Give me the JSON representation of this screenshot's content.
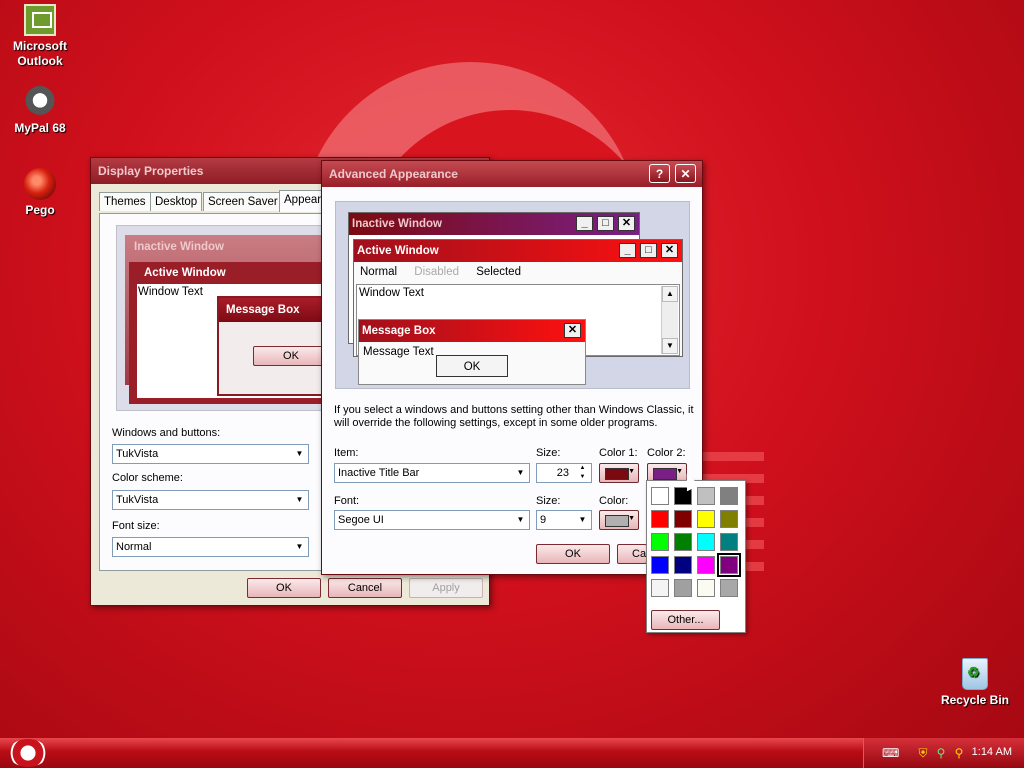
{
  "desktop": {
    "icons": [
      {
        "label_line1": "Microsoft",
        "label_line2": "Outlook",
        "icon": "outlook-icon"
      },
      {
        "label_line1": "MyPal 68",
        "label_line2": "",
        "icon": "mypal-icon"
      },
      {
        "label_line1": "Pego",
        "label_line2": "",
        "icon": "pego-icon"
      },
      {
        "label_line1": "Recycle Bin",
        "label_line2": "",
        "icon": "recycle-bin-icon"
      }
    ]
  },
  "display_properties": {
    "title": "Display Properties",
    "tabs": [
      "Themes",
      "Desktop",
      "Screen Saver",
      "Appearance"
    ],
    "preview": {
      "inactive_title": "Inactive Window",
      "active_title": "Active Window",
      "window_text": "Window Text",
      "message_box_title": "Message Box",
      "ok": "OK"
    },
    "windows_buttons_label": "Windows and buttons:",
    "windows_buttons_value": "TukVista",
    "color_scheme_label": "Color scheme:",
    "color_scheme_value": "TukVista",
    "font_size_label": "Font size:",
    "font_size_value": "Normal",
    "ok": "OK",
    "cancel": "Cancel",
    "apply": "Apply"
  },
  "advanced_appearance": {
    "title": "Advanced Appearance",
    "help_btn": "?",
    "close_btn": "✕",
    "preview": {
      "inactive_title": "Inactive Window",
      "active_title": "Active Window",
      "menu_normal": "Normal",
      "menu_disabled": "Disabled",
      "menu_selected": "Selected",
      "window_text": "Window Text",
      "message_box_title": "Message Box",
      "message_text": "Message Text",
      "ok": "OK"
    },
    "notice": "If you select a windows and buttons setting other than Windows Classic, it will override the following settings, except in some older programs.",
    "item_label": "Item:",
    "item_value": "Inactive Title Bar",
    "size_label": "Size:",
    "item_size_value": "23",
    "color1_label": "Color 1:",
    "color2_label": "Color 2:",
    "font_label": "Font:",
    "font_value": "Segoe UI",
    "font_size_label": "Size:",
    "font_size_value": "9",
    "font_color_label": "Color:",
    "ok": "OK",
    "cancel": "Ca",
    "colors": {
      "color1": "#7b0a10",
      "color2": "#7a1f86",
      "font_color": "#b0b0b0"
    }
  },
  "color_popup": {
    "swatches": [
      "#ffffff",
      "#000000",
      "#c0c0c0",
      "#808080",
      "#ff0000",
      "#800000",
      "#ffff00",
      "#808000",
      "#00ff00",
      "#008000",
      "#00ffff",
      "#008080",
      "#0000ff",
      "#000080",
      "#ff00ff",
      "#800080",
      "#f4f4f4",
      "#a0a0a0",
      "#fbfbf4",
      "#a8a8a8"
    ],
    "selected_index": 15,
    "other_label": "Other..."
  },
  "taskbar": {
    "clock": "1:14 AM"
  }
}
